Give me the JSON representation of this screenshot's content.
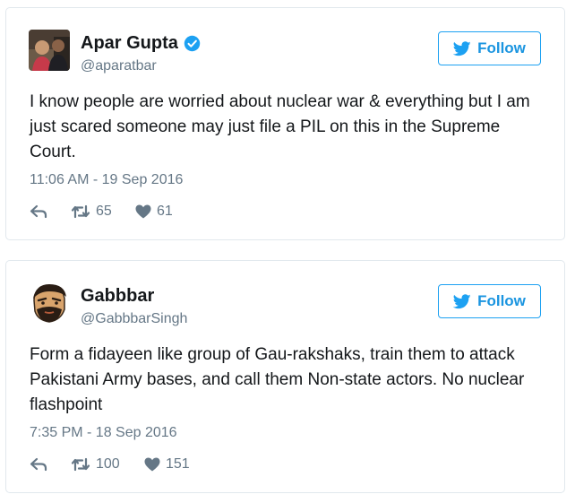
{
  "tweets": [
    {
      "name": "Apar Gupta",
      "handle": "@aparatbar",
      "verified": true,
      "follow_label": "Follow",
      "text": "I know people are worried about nuclear war & everything but I am just scared someone may just file a PIL on this in the Supreme Court.",
      "timestamp": "11:06 AM - 19 Sep 2016",
      "retweets": "65",
      "likes": "61"
    },
    {
      "name": "Gabbbar",
      "handle": "@GabbbarSingh",
      "verified": false,
      "follow_label": "Follow",
      "text": "Form a fidayeen like group of Gau-rakshaks, train them to attack Pakistani Army bases, and call them Non-state actors. No nuclear flashpoint",
      "timestamp": "7:35 PM - 18 Sep 2016",
      "retweets": "100",
      "likes": "151"
    }
  ],
  "colors": {
    "accent": "#1da1f2",
    "muted": "#657786",
    "border": "#e1e8ed"
  },
  "icons": [
    "verified-badge-icon",
    "twitter-bird-icon",
    "reply-icon",
    "retweet-icon",
    "heart-icon"
  ]
}
